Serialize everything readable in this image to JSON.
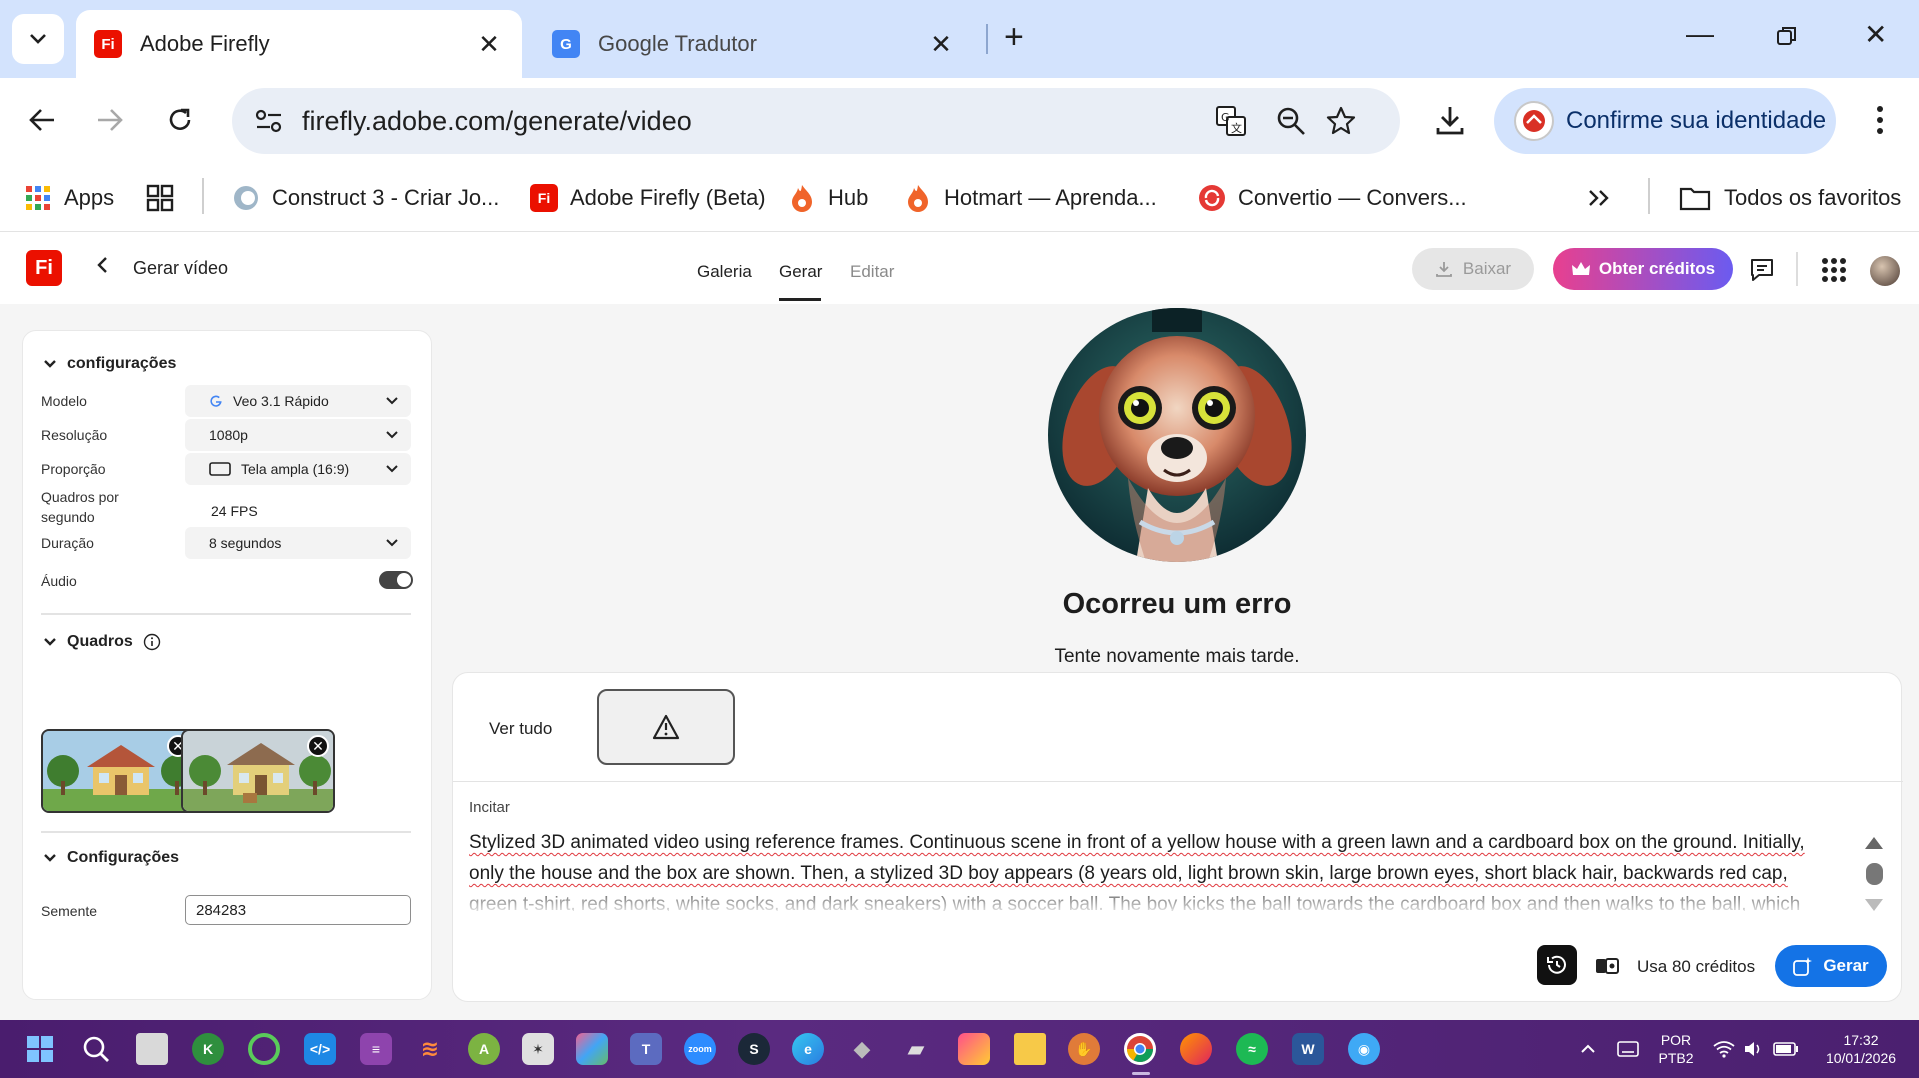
{
  "browser": {
    "tabs": [
      {
        "title": "Adobe Firefly",
        "favicon": "Fi",
        "active": true
      },
      {
        "title": "Google Tradutor",
        "favicon": "G",
        "active": false
      }
    ],
    "url": "firefly.adobe.com/generate/video",
    "identity_button": "Confirme sua identidade",
    "bookmarks": [
      {
        "label": "Apps"
      },
      {
        "label": "Construct 3 - Criar Jo..."
      },
      {
        "label": "Adobe Firefly (Beta)"
      },
      {
        "label": "Hub"
      },
      {
        "label": "Hotmart — Aprenda..."
      },
      {
        "label": "Convertio — Convers..."
      }
    ],
    "all_bookmarks": "Todos os favoritos"
  },
  "app": {
    "page_title": "Gerar vídeo",
    "nav_tabs": [
      "Galeria",
      "Gerar",
      "Editar"
    ],
    "download_label": "Baixar",
    "credits_label": "Obter créditos"
  },
  "settings": {
    "section_title": "configurações",
    "rows": {
      "model_label": "Modelo",
      "model_value": "Veo 3.1 Rápido",
      "resolution_label": "Resolução",
      "resolution_value": "1080p",
      "aspect_label": "Proporção",
      "aspect_value": "Tela ampla (16:9)",
      "fps_label": "Quadros por segundo",
      "fps_value": "24 FPS",
      "duration_label": "Duração",
      "duration_value": "8 segundos",
      "audio_label": "Áudio"
    },
    "audio_enabled": true,
    "frames_title": "Quadros",
    "config_title": "Configurações",
    "seed_label": "Semente",
    "seed_value": "284283"
  },
  "error": {
    "title": "Ocorreu um erro",
    "subtitle": "Tente novamente mais tarde."
  },
  "prompt_card": {
    "view_all": "Ver tudo",
    "prompt_label": "Incitar",
    "prompt_text": "Stylized 3D animated video using reference frames. Continuous scene in front of a yellow house with a green lawn and a cardboard box on the ground. Initially, only the house and the box are shown. Then, a stylized 3D boy appears (8 years old, light brown skin, large brown eyes, short black hair, backwards red cap, green t-shirt, red shorts, white socks, and dark sneakers) with a soccer ball. The boy kicks the ball towards the cardboard box and then walks to the ball, which stops next to the box.",
    "credits_text": "Usa 80 créditos",
    "generate_label": "Gerar"
  },
  "taskbar": {
    "lang_top": "POR",
    "lang_bottom": "PTB2",
    "time": "17:32",
    "date": "10/01/2026"
  },
  "colors": {
    "accent_blue": "#1473e6",
    "firefly_red": "#eb1000",
    "tab_strip": "#d3e3fd"
  }
}
